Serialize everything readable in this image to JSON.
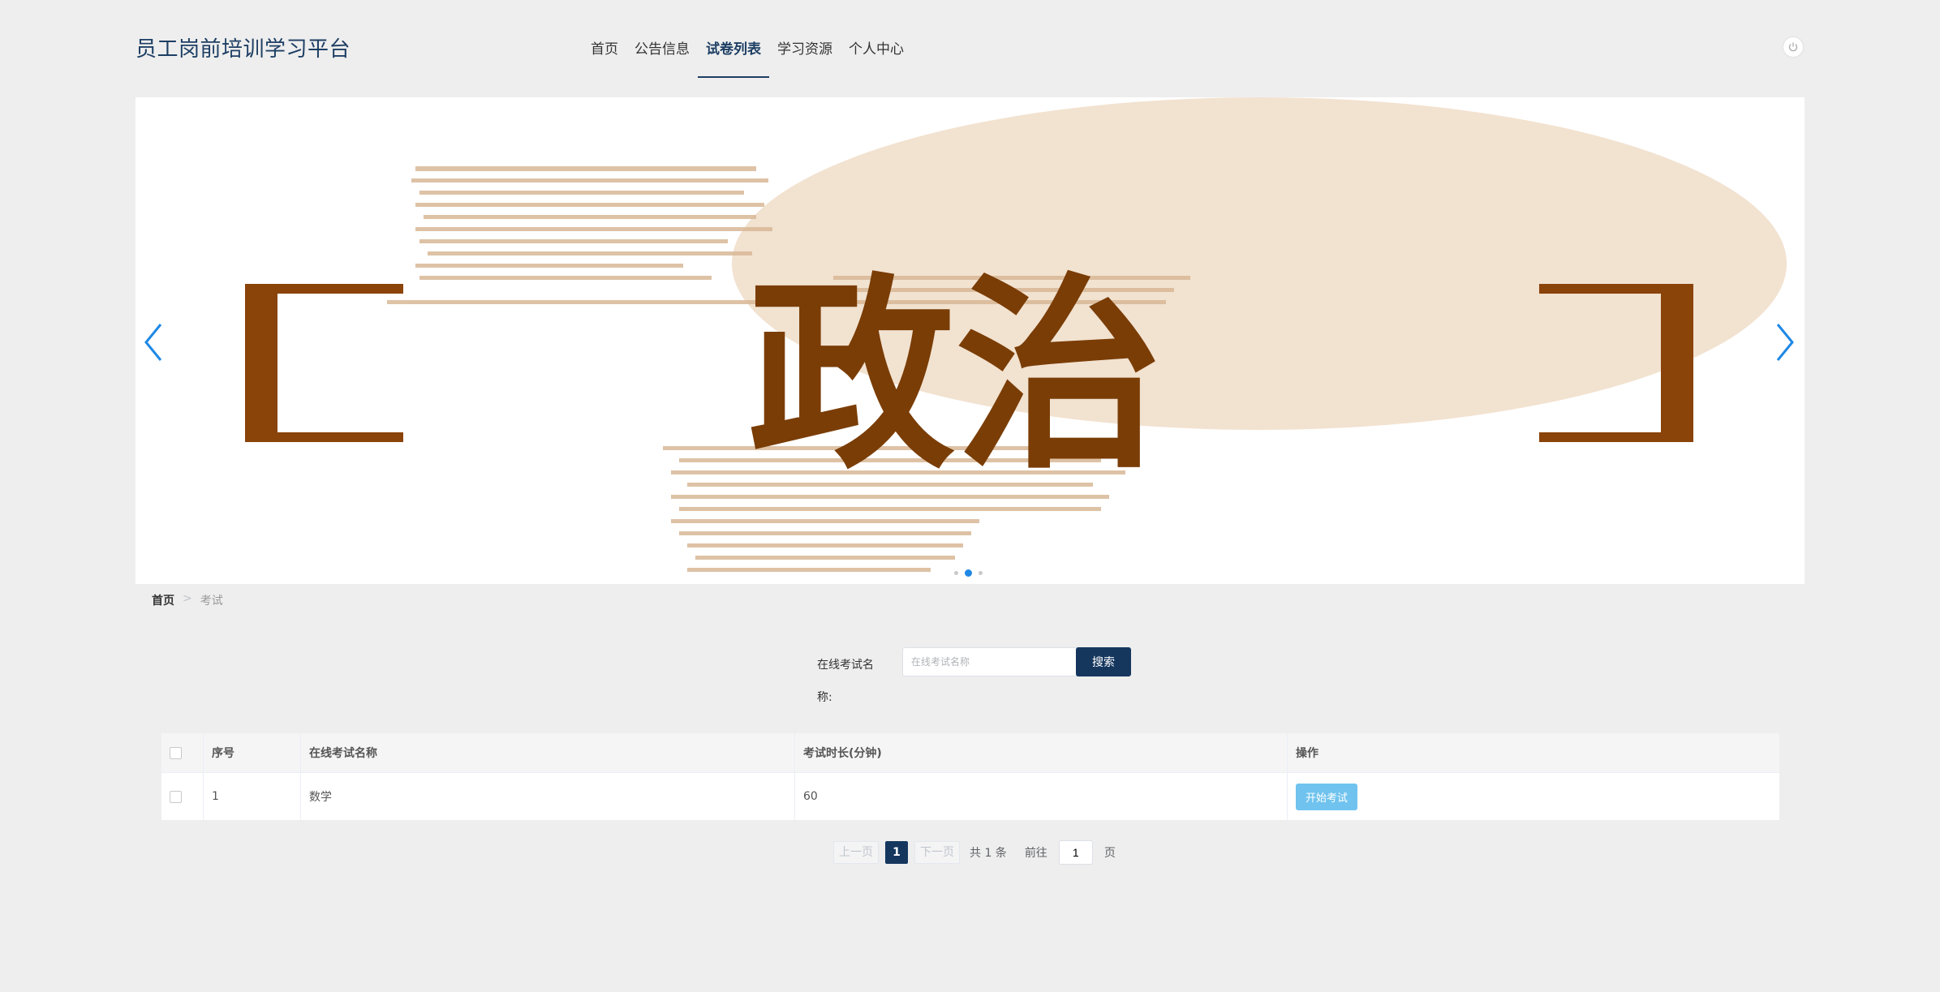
{
  "header": {
    "title": "员工岗前培训学习平台",
    "nav": [
      "首页",
      "公告信息",
      "试卷列表",
      "学习资源",
      "个人中心"
    ],
    "active_nav": "试卷列表"
  },
  "banner": {
    "text": "政治",
    "slide_count": 3,
    "active_slide": 2
  },
  "breadcrumb": {
    "home": "首页",
    "separator": ">",
    "current": "考试"
  },
  "search": {
    "label": "在线考试名称:",
    "placeholder": "在线考试名称",
    "button": "搜索"
  },
  "table": {
    "headers": [
      "序号",
      "在线考试名称",
      "考试时长(分钟)",
      "操作"
    ],
    "rows": [
      {
        "index": "1",
        "name": "数学",
        "duration": "60",
        "action": "开始考试"
      }
    ]
  },
  "pagination": {
    "prev": "上一页",
    "current_page": "1",
    "next": "下一页",
    "total": "共 1 条",
    "goto_label": "前往",
    "goto_value": "1",
    "page_unit": "页"
  },
  "colors": {
    "primary": "#15375e",
    "accent_blue": "#1e88e5",
    "start_button": "#6fc3ee",
    "banner_brown": "#7a3d06"
  }
}
